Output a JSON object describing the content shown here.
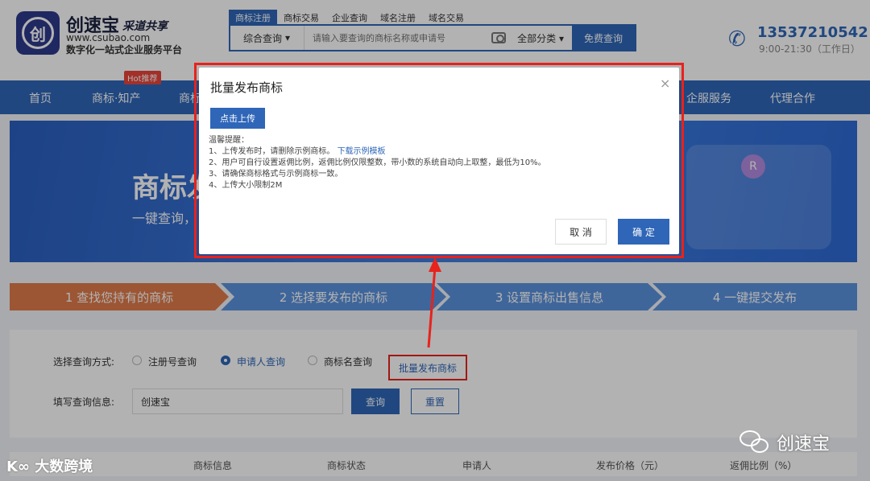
{
  "header": {
    "brand_name": "创速宝",
    "brand_tag": "采道共享",
    "brand_url": "www.csubao.com",
    "brand_slogan": "数字化一站式企业服务平台",
    "search_tabs": [
      "商标注册",
      "商标交易",
      "企业查询",
      "域名注册",
      "域名交易"
    ],
    "search_type": "综合查询",
    "search_placeholder": "请输入要查询的商标名称或申请号",
    "search_category": "全部分类",
    "search_button": "免费查询",
    "phone": "13537210542",
    "hours": "9:00-21:30（工作日）"
  },
  "nav": {
    "items": [
      "首页",
      "商标·知产",
      "商标",
      "企服服务",
      "代理合作"
    ],
    "hot_badge": "Hot推荐"
  },
  "banner": {
    "title": "商标发",
    "subtitle": "一键查询，",
    "r_mark": "R"
  },
  "steps": [
    "1 查找您持有的商标",
    "2 选择要发布的商标",
    "3 设置商标出售信息",
    "4 一键提交发布"
  ],
  "query": {
    "method_label": "选择查询方式:",
    "options": [
      "注册号查询",
      "申请人查询",
      "商标名查询"
    ],
    "batch_link": "批量发布商标",
    "info_label": "填写查询信息:",
    "input_value": "创速宝",
    "search_button": "查询",
    "reset_button": "重置"
  },
  "table": {
    "columns": [
      "商标信息",
      "商标状态",
      "申请人",
      "发布价格（元）",
      "返佣比例（%）"
    ]
  },
  "modal": {
    "title": "批量发布商标",
    "close": "×",
    "upload_button": "点击上传",
    "tips_title": "温馨提醒：",
    "tip1": "1、上传发布时，请删除示例商标。",
    "tip1_link": "下载示例模板",
    "tip2": "2、用户可自行设置返佣比例，返佣比例仅限整数，带小数的系统自动向上取整，最低为10%。",
    "tip3": "3、请确保商标格式与示例商标一致。",
    "tip4": "4、上传大小限制2M",
    "cancel_button": "取 消",
    "ok_button": "确 定"
  },
  "watermarks": {
    "left": "大数跨境",
    "right": "创速宝"
  },
  "colors": {
    "primary": "#2f66b8",
    "annotation": "#e8221c",
    "step_active": "#e07b4b"
  }
}
